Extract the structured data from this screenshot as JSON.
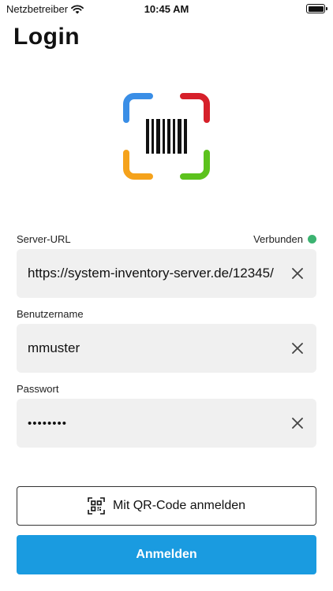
{
  "status_bar": {
    "carrier": "Netzbetreiber",
    "time": "10:45 AM"
  },
  "title": "Login",
  "colors": {
    "accent": "#1a9be0",
    "connected": "#3cb371",
    "logo_blue": "#3a8ee6",
    "logo_red": "#d6202a",
    "logo_orange": "#f5a21b",
    "logo_green": "#5cc21d"
  },
  "server": {
    "label": "Server-URL",
    "status": "Verbunden",
    "value": "https://system-inventory-server.de/12345/"
  },
  "username": {
    "label": "Benutzername",
    "value": "mmuster"
  },
  "password": {
    "label": "Passwort",
    "value": "••••••••"
  },
  "buttons": {
    "qr_label": "Mit QR-Code anmelden",
    "login_label": "Anmelden"
  }
}
